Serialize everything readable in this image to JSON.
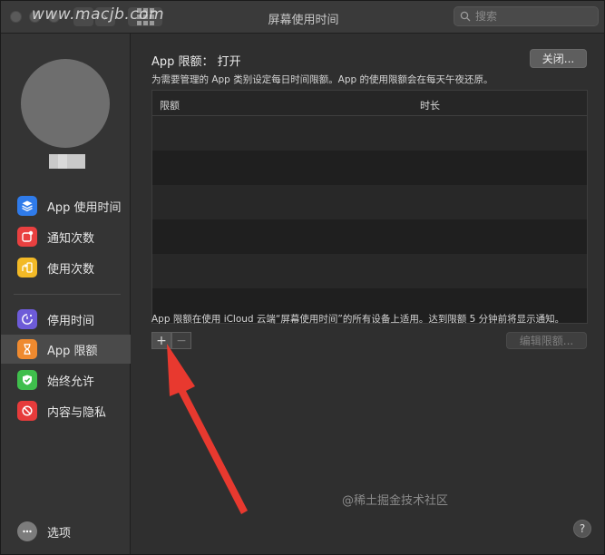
{
  "window": {
    "title": "屏幕使用时间",
    "watermark": "www.macjb.com"
  },
  "search": {
    "placeholder": "搜索"
  },
  "sidebar": {
    "items": [
      {
        "label": "App 使用时间",
        "icon": "stack-icon",
        "color": "#2f7bea"
      },
      {
        "label": "通知次数",
        "icon": "notification-icon",
        "color": "#e94040"
      },
      {
        "label": "使用次数",
        "icon": "pickup-icon",
        "color": "#f2b926"
      },
      {
        "label": "停用时间",
        "icon": "downtime-icon",
        "color": "#6d5bd8"
      },
      {
        "label": "App 限额",
        "icon": "hourglass-icon",
        "color": "#ef8a2f"
      },
      {
        "label": "始终允许",
        "icon": "checkmark-shield-icon",
        "color": "#3fbe4c"
      },
      {
        "label": "内容与隐私",
        "icon": "no-sign-icon",
        "color": "#e63b3b"
      }
    ],
    "options_label": "选项"
  },
  "main": {
    "title": "App 限额：  打开",
    "close_button": "关闭...",
    "description": "为需要管理的 App 类别设定每日时间限额。App 的使用限额会在每天午夜还原。",
    "table": {
      "columns": [
        "限额",
        "时长"
      ],
      "rows": []
    },
    "footnote": "App 限额在使用 iCloud 云端“屏幕使用时间”的所有设备上适用。达到限额 5 分钟前将显示通知。",
    "add_button": "+",
    "remove_button": "−",
    "edit_button": "编辑限额...",
    "help_button": "?"
  },
  "credit": "@稀土掘金技术社区",
  "colors": {
    "arrow": "#e8392f"
  }
}
